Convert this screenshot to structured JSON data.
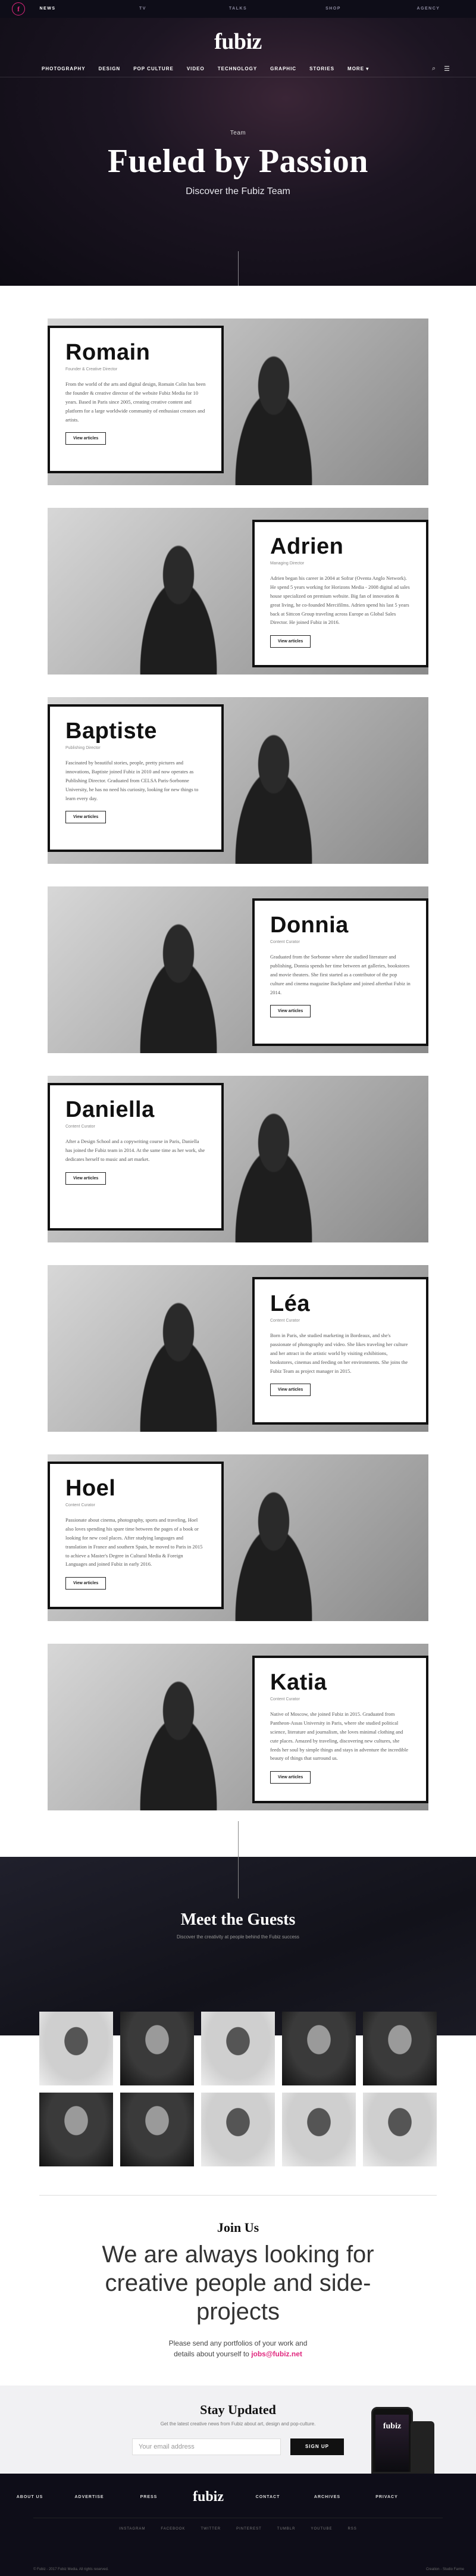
{
  "topbar": {
    "logo": "f",
    "links": [
      "NEWS",
      "TV",
      "TALKS",
      "SHOP",
      "AGENCY"
    ],
    "active": "NEWS"
  },
  "brand": "fubiz",
  "nav": {
    "items": [
      "PHOTOGRAPHY",
      "DESIGN",
      "POP CULTURE",
      "VIDEO",
      "TECHNOLOGY",
      "GRAPHIC",
      "STORIES",
      "MORE"
    ],
    "more_caret": "▾",
    "search_icon": "⌕",
    "menu_icon": "☰"
  },
  "hero": {
    "eyebrow": "Team",
    "title": "Fueled by Passion",
    "subtitle": "Discover the Fubiz Team"
  },
  "team": [
    {
      "name": "Romain",
      "role": "Founder & Creative Director",
      "bio": "From the world of the arts and digital design, Romain Colin has been the founder & creative director of the website Fubiz Media for 10 years. Based in Paris since 2005, creating creative content and platform for a large worldwide community of enthusiast creators and artists.",
      "button": "View articles",
      "side": "left"
    },
    {
      "name": "Adrien",
      "role": "Managing Director",
      "bio": "Adrien began his career in 2004 at Sofrar (Oventa Anglo Network). He spend 5 years working for Horizons Media - 2008 digital ad sales house specialized on premium website. Big fan of innovation & great living, he co-founded Mercifilms. Adrien spend his last 5 years back at Sittcon Group traveling across Europe as Global Sales Director. He joined Fubiz in 2016.",
      "button": "View articles",
      "side": "right"
    },
    {
      "name": "Baptiste",
      "role": "Publishing Director",
      "bio": "Fascinated by beautiful stories, people, pretty pictures and innovations, Baptiste joined Fubiz in 2010 and now operates as Publishing Director. Graduated from CELSA Paris-Sorbonne University, he has no need his curiosity, looking for new things to learn every day.",
      "button": "View articles",
      "side": "left"
    },
    {
      "name": "Donnia",
      "role": "Content Curator",
      "bio": "Graduated from the Sorbonne where she studied literature and publishing, Donnia spends her time between art galleries, bookstores and movie theaters. She first started as a contributor of the pop culture and cinema magazine Backplane and joined afterthat Fubiz in 2014.",
      "button": "View articles",
      "side": "right"
    },
    {
      "name": "Daniella",
      "role": "Content Curator",
      "bio": "After a Design School and a copywriting course in Paris, Daniella has joined the Fubiz team in 2014. At the same time as her work, she dedicates herself to music and art market.",
      "button": "View articles",
      "side": "left"
    },
    {
      "name": "Léa",
      "role": "Content Curator",
      "bio": "Born in Paris, she studied marketing in Bordeaux, and she's passionate of photography and video. She likes traveling her culture and her attract in the artistic world by visiting exhibitions, bookstores, cinemas and feeding on her environments. She joins the Fubiz Team as project manager in 2015.",
      "button": "View articles",
      "side": "right"
    },
    {
      "name": "Hoel",
      "role": "Content Curator",
      "bio": "Passionate about cinema, photography, sports and traveling, Hoel also loves spending his spare time between the pages of a book or looking for new cool places. After studying languages and translation in France and southern Spain, he moved to Paris in 2015 to achieve a Master's Degree in Cultural Media & Foreign Languages and joined Fubiz in early 2016.",
      "button": "View articles",
      "side": "left"
    },
    {
      "name": "Katia",
      "role": "Content Curator",
      "bio": "Native of Moscow, she joined Fubiz in 2015. Graduated from Pantheon-Assas University in Paris, where she studied political science, literature and journalism, she loves minimal clothing and cute places. Amazed by traveling, discovering new cultures, she feeds her soul by simple things and stays in adventure the incredible beauty of things that surround us.",
      "button": "View articles",
      "side": "right"
    }
  ],
  "guests": {
    "title": "Meet the Guests",
    "subtitle": "Discover the creativity at people behind the Fubiz success"
  },
  "join": {
    "title": "Join Us",
    "big": "We are always looking for creative people and side-projects",
    "line1": "Please send any portfolios of your work and",
    "line2_prefix": "details about yourself to ",
    "email": "jobs@fubiz.net"
  },
  "newsletter": {
    "title": "Stay Updated",
    "text": "Get the latest creative news from Fubiz about art, design and pop-culture.",
    "placeholder": "Your email address",
    "button": "SIGN UP",
    "phone_brand": "fubiz"
  },
  "footer": {
    "links_left": [
      "ABOUT US",
      "ADVERTISE",
      "PRESS"
    ],
    "brand": "fubiz",
    "links_right": [
      "CONTACT",
      "ARCHIVES",
      "PRIVACY"
    ],
    "social": [
      "INSTAGRAM",
      "FACEBOOK",
      "TWITTER",
      "PINTEREST",
      "TUMBLR",
      "YOUTUBE",
      "RSS"
    ],
    "copyright": "© Fubiz - 2017 Fubiz Media. All rights reserved.",
    "credit": "Creation - Studio Farme"
  },
  "colors": {
    "accent": "#e0267d",
    "dark": "#0e0d18"
  }
}
